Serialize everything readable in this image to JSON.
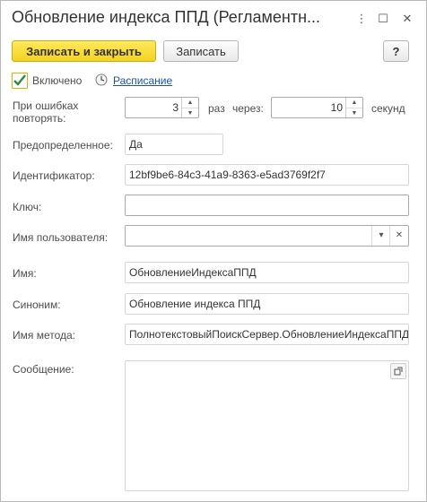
{
  "window": {
    "title": "Обновление индекса ППД (Регламентн...",
    "menu_glyph": "⋮",
    "max_glyph": "☐",
    "close_glyph": "✕"
  },
  "toolbar": {
    "save_close_label": "Записать и закрыть",
    "save_label": "Записать",
    "help_label": "?"
  },
  "enabled": {
    "label": "Включено",
    "checked": true
  },
  "schedule_link": "Расписание",
  "retry": {
    "label": "При ошибках повторять:",
    "count": "3",
    "times_label": "раз",
    "through_label": "через:",
    "seconds": "10",
    "seconds_label": "секунд"
  },
  "fields": {
    "predefined_label": "Предопределенное:",
    "predefined_value": "Да",
    "identifier_label": "Идентификатор:",
    "identifier_value": "12bf9be6-84c3-41a9-8363-e5ad3769f2f7",
    "key_label": "Ключ:",
    "key_value": "",
    "user_label": "Имя пользователя:",
    "user_value": "",
    "name_label": "Имя:",
    "name_value": "ОбновлениеИндексаППД",
    "synonym_label": "Синоним:",
    "synonym_value": "Обновление индекса ППД",
    "method_label": "Имя метода:",
    "method_value": "ПолнотекстовыйПоискСервер.ОбновлениеИндексаППД",
    "message_label": "Сообщение:",
    "message_value": ""
  }
}
